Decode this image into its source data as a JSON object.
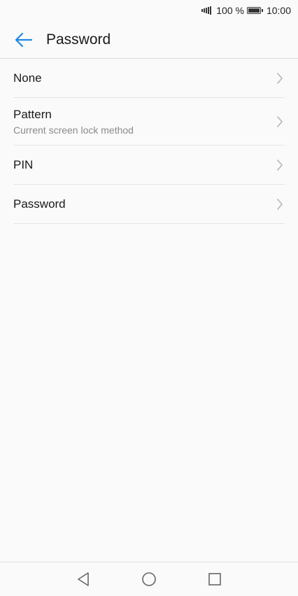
{
  "status_bar": {
    "battery_percent": "100 %",
    "time": "10:00",
    "battery_level": 1.0
  },
  "header": {
    "title": "Password",
    "back_icon": "arrow-left-icon"
  },
  "options": [
    {
      "title": "None",
      "subtitle": ""
    },
    {
      "title": "Pattern",
      "subtitle": "Current screen lock method"
    },
    {
      "title": "PIN",
      "subtitle": ""
    },
    {
      "title": "Password",
      "subtitle": ""
    }
  ],
  "nav_bar": {
    "back_icon": "triangle-back-icon",
    "home_icon": "circle-home-icon",
    "recents_icon": "square-recents-icon"
  },
  "colors": {
    "accent": "#1e88e5",
    "background": "#fafafa",
    "chevron": "#b5b5b5",
    "nav_icon": "#666666"
  }
}
